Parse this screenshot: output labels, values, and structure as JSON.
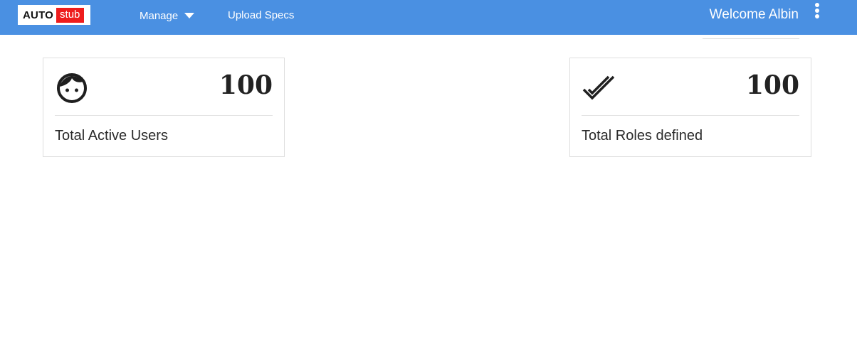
{
  "header": {
    "logo": {
      "part1": "AUTO",
      "part2": "stub"
    },
    "nav": {
      "manage_label": "Manage",
      "upload_label": "Upload Specs"
    },
    "welcome": "Welcome Albin",
    "menu_icon": "kebab-menu-icon"
  },
  "cards": [
    {
      "icon": "face-icon",
      "count": "100",
      "label": "Total Active Users"
    },
    {
      "icon": "double-check-icon",
      "count": "100",
      "label": "Total Roles defined"
    }
  ],
  "colors": {
    "header_bg": "#4a90e2",
    "logo_accent": "#ee1c1c",
    "text_dark": "#222222",
    "card_border": "#dedede"
  }
}
